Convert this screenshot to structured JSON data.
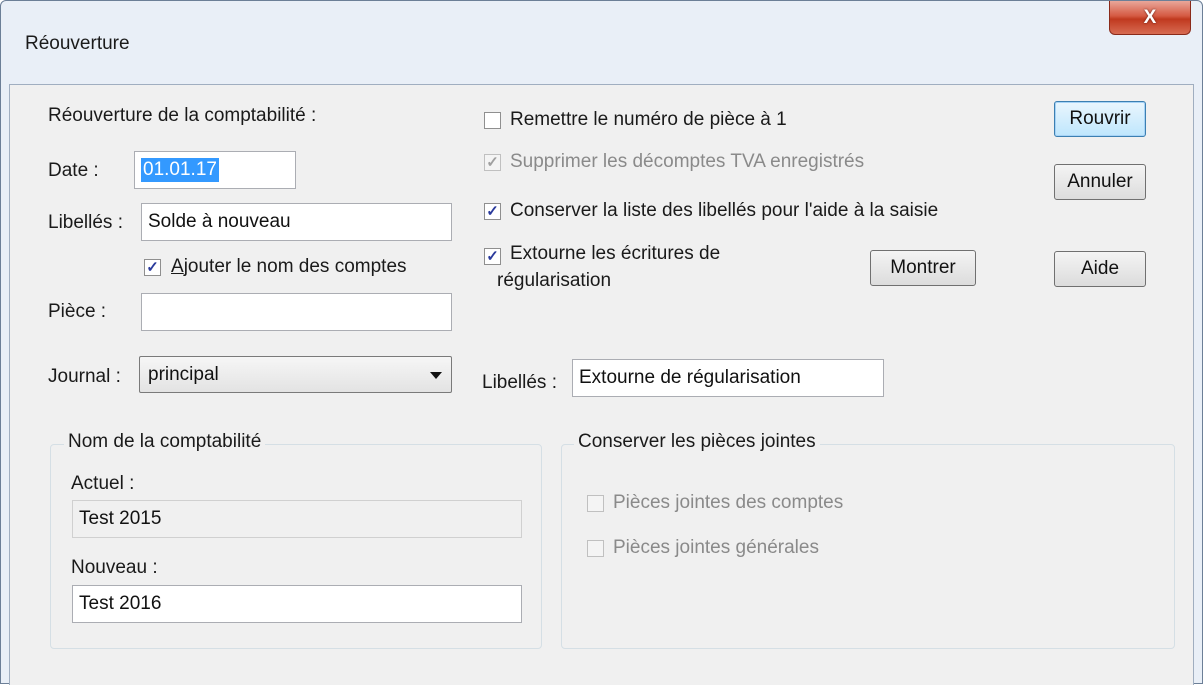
{
  "window": {
    "title": "Réouverture",
    "close_label": "X"
  },
  "left": {
    "section_label": "Réouverture de la comptabilité :",
    "date_label": "Date :",
    "date_value": "01.01.17",
    "libelles_label": "Libellés :",
    "libelles_value": "Solde à nouveau",
    "add_account_names": {
      "label_first": "A",
      "label_rest": "jouter le nom des comptes",
      "checked": true
    },
    "piece_label": "Pièce :",
    "piece_value": "",
    "journal_label": "Journal :",
    "journal_value": "principal"
  },
  "options": {
    "reset_piece_number": {
      "label": "Remettre le numéro de pièce à 1",
      "checked": false,
      "enabled": true
    },
    "delete_vat": {
      "label": "Supprimer les décomptes TVA enregistrés",
      "checked": true,
      "enabled": false
    },
    "keep_labels": {
      "label": "Conserver la liste des libellés pour l'aide à la saisie",
      "checked": true,
      "enabled": true
    },
    "reverse_entries": {
      "label_line1": "Extourne les écritures de",
      "label_line2": "régularisation",
      "checked": true,
      "enabled": true
    },
    "show_button": "Montrer",
    "reverse_libelles_label": "Libellés :",
    "reverse_libelles_value": "Extourne de régularisation"
  },
  "buttons": {
    "reopen": "Rouvrir",
    "cancel": "Annuler",
    "help": "Aide"
  },
  "name_group": {
    "title": "Nom de la comptabilité",
    "current_label": "Actuel :",
    "current_value": "Test 2015",
    "new_label": "Nouveau :",
    "new_value": "Test 2016"
  },
  "attachments_group": {
    "title": "Conserver les pièces jointes",
    "account_attachments": {
      "label": "Pièces jointes des comptes",
      "checked": false,
      "enabled": false
    },
    "general_attachments": {
      "label": "Pièces jointes générales",
      "checked": false,
      "enabled": false
    }
  }
}
